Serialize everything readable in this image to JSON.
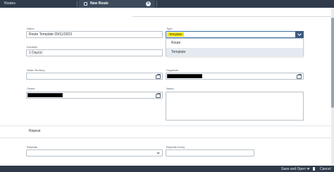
{
  "tabs": {
    "routes_label": "Routes",
    "new_route_label": "New Route"
  },
  "form": {
    "name": {
      "label": "Name",
      "value": "Route Template 09/11/2023"
    },
    "type": {
      "label": "Type",
      "selected": "Template",
      "options": [
        "Route",
        "Template"
      ],
      "highlighted_option": "Template"
    },
    "duration": {
      "label": "Duration",
      "value": "1 Day(s)"
    },
    "sales_territory": {
      "label": "Sales Territory",
      "value": ""
    },
    "organizer": {
      "label": "Organizer",
      "value_redacted": true
    },
    "owner": {
      "label": "Owner",
      "value_redacted": true
    },
    "notes": {
      "label": "Notes",
      "value": ""
    }
  },
  "repeat_section": {
    "title": "Repeat",
    "repeats": {
      "label": "Repeats",
      "value": ""
    },
    "repeats_every": {
      "label": "Repeats Every",
      "value": ""
    }
  },
  "footer": {
    "save_open_label": "Save and Open",
    "cancel_label": "Cancel"
  },
  "colors": {
    "shell": "#2f3b4a",
    "accent": "#3c5a80",
    "highlight": "#f6e600"
  }
}
